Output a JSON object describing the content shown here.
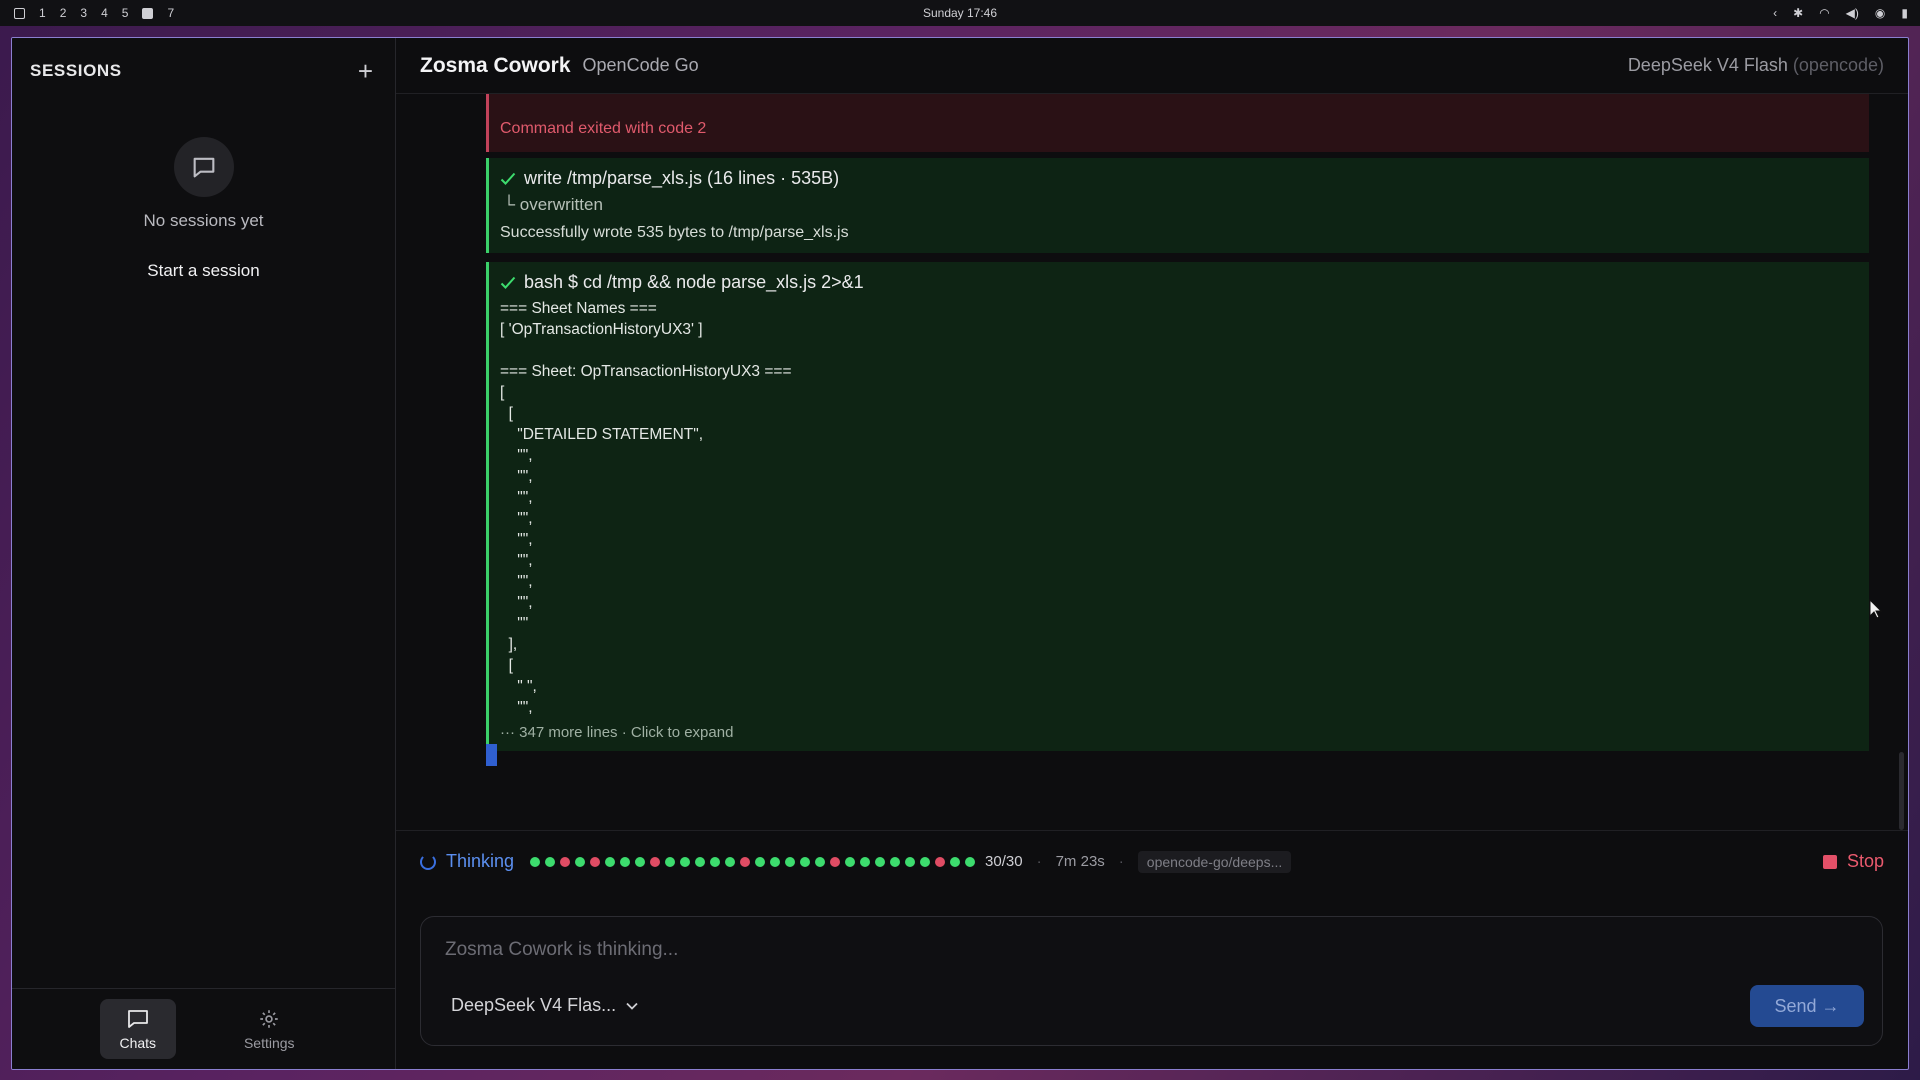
{
  "topbar": {
    "workspaces": [
      "1",
      "2",
      "3",
      "4",
      "5",
      "7"
    ],
    "clock": "Sunday 17:46"
  },
  "sidebar": {
    "title": "SESSIONS",
    "empty_text": "No sessions yet",
    "start_label": "Start a session",
    "footer": {
      "chats": "Chats",
      "settings": "Settings"
    }
  },
  "header": {
    "title": "Zosma Cowork",
    "subtitle": "OpenCode Go",
    "model": "DeepSeek V4 Flash",
    "provider": "(opencode)"
  },
  "log": {
    "error_text": "Command exited with code 2",
    "write_block": {
      "title": "write /tmp/parse_xls.js (16 lines · 535B)",
      "sub": "└ overwritten",
      "output": "Successfully wrote 535 bytes to /tmp/parse_xls.js"
    },
    "bash_block": {
      "title": "bash $ cd /tmp && node parse_xls.js 2>&1",
      "lines": [
        "=== Sheet Names ===",
        "[ 'OpTransactionHistoryUX3' ]",
        "",
        "=== Sheet: OpTransactionHistoryUX3 ===",
        "[",
        "  [",
        "    \"DETAILED STATEMENT\",",
        "    \"\",",
        "    \"\",",
        "    \"\",",
        "    \"\",",
        "    \"\",",
        "    \"\",",
        "    \"\",",
        "    \"\",",
        "    \"\"",
        "  ],",
        "  [",
        "    \" \",",
        "    \"\","
      ],
      "more": "··· 347 more lines · Click to expand"
    }
  },
  "status": {
    "label": "Thinking",
    "progress": "30/30",
    "elapsed": "7m 23s",
    "model_pill": "opencode-go/deeps...",
    "stop_label": "Stop",
    "dot_colors": [
      "#3ddc6e",
      "#3ddc6e",
      "#e04c64",
      "#3ddc6e",
      "#e04c64",
      "#3ddc6e",
      "#3ddc6e",
      "#3ddc6e",
      "#e04c64",
      "#3ddc6e",
      "#3ddc6e",
      "#3ddc6e",
      "#3ddc6e",
      "#3ddc6e",
      "#e04c64",
      "#3ddc6e",
      "#3ddc6e",
      "#3ddc6e",
      "#3ddc6e",
      "#3ddc6e",
      "#e04c64",
      "#3ddc6e",
      "#3ddc6e",
      "#3ddc6e",
      "#3ddc6e",
      "#3ddc6e",
      "#3ddc6e",
      "#e04c64",
      "#3ddc6e",
      "#3ddc6e"
    ]
  },
  "composer": {
    "placeholder": "Zosma Cowork is thinking...",
    "model_label": "DeepSeek V4 Flas...",
    "send_label": "Send →"
  }
}
